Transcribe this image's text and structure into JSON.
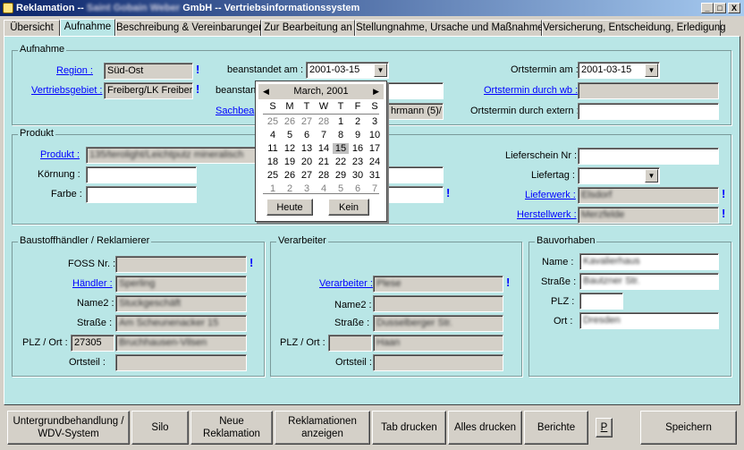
{
  "window": {
    "title": "Reklamation -- Saint Gobain Weber GmbH -- Vertriebsinformationssystem",
    "title_visible": "Reklamation --",
    "title_blurred": "Saint Gobain Weber",
    "title_rest": "GmbH -- Vertriebsinformationssystem",
    "min": "_",
    "max": "□",
    "close": "X"
  },
  "tabs": [
    "Übersicht",
    "Aufnahme",
    "Beschreibung & Vereinbarungen",
    "Zur Bearbeitung an",
    "Stellungnahme, Ursache und Maßnahmen",
    "Versicherung, Entscheidung, Erledigung"
  ],
  "aufnahme": {
    "title": "Aufnahme",
    "region_label": "Region :",
    "region_value": "Süd-Ost",
    "vertrieb_label": "Vertriebsgebiet :",
    "vertrieb_value": "Freiberg/LK Freiber",
    "beanstandet_label": "beanstandet am :",
    "beanstandet_value": "2001-03-15",
    "beanstandet2_label": "beanstan",
    "sachbe_label": "Sachbea",
    "sachbe_value": "hrmann (5)/",
    "ortstermin_label": "Ortstermin am :",
    "ortstermin_value": "2001-03-15",
    "ortstermin_wb_label": "Ortstermin durch wb :",
    "ortstermin_ext_label": "Ortstermin durch extern :"
  },
  "calendar": {
    "month": "March, 2001",
    "weekdays": [
      "S",
      "M",
      "T",
      "W",
      "T",
      "F",
      "S"
    ],
    "rows": [
      [
        [
          "25",
          1
        ],
        [
          "26",
          1
        ],
        [
          "27",
          1
        ],
        [
          "28",
          1
        ],
        [
          "1",
          0
        ],
        [
          "2",
          0
        ],
        [
          "3",
          0
        ]
      ],
      [
        [
          "4",
          0
        ],
        [
          "5",
          0
        ],
        [
          "6",
          0
        ],
        [
          "7",
          0
        ],
        [
          "8",
          0
        ],
        [
          "9",
          0
        ],
        [
          "10",
          0
        ]
      ],
      [
        [
          "11",
          0
        ],
        [
          "12",
          0
        ],
        [
          "13",
          0
        ],
        [
          "14",
          0
        ],
        [
          "15",
          2
        ],
        [
          "16",
          0
        ],
        [
          "17",
          0
        ]
      ],
      [
        [
          "18",
          0
        ],
        [
          "19",
          0
        ],
        [
          "20",
          0
        ],
        [
          "21",
          0
        ],
        [
          "22",
          0
        ],
        [
          "23",
          0
        ],
        [
          "24",
          0
        ]
      ],
      [
        [
          "25",
          0
        ],
        [
          "26",
          0
        ],
        [
          "27",
          0
        ],
        [
          "28",
          0
        ],
        [
          "29",
          0
        ],
        [
          "30",
          0
        ],
        [
          "31",
          0
        ]
      ],
      [
        [
          "1",
          1
        ],
        [
          "2",
          1
        ],
        [
          "3",
          1
        ],
        [
          "4",
          1
        ],
        [
          "5",
          1
        ],
        [
          "6",
          1
        ],
        [
          "7",
          1
        ]
      ]
    ],
    "today_btn": "Heute",
    "none_btn": "Kein"
  },
  "produkt": {
    "title": "Produkt",
    "produkt_label": "Produkt :",
    "produkt_value": "135/terolight/Leichtputz mineralisch",
    "koernung_label": "Körnung :",
    "farbe_label": "Farbe :",
    "lieferschein_label": "Lieferschein Nr :",
    "liefertag_label": "Liefertag :",
    "lieferwerk_label": "Lieferwerk :",
    "lieferwerk_value": "Elsdorf",
    "herstellwerk_label": "Herstellwerk :",
    "herstellwerk_value": "Merzfelde"
  },
  "baustoff": {
    "title": "Baustoffhändler / Reklamierer",
    "foss_label": "FOSS Nr. :",
    "haendler_label": "Händler :",
    "haendler_value": "Sperling",
    "name2_label": "Name2 :",
    "name2_value": "Stuckgeschäft",
    "strasse_label": "Straße :",
    "strasse_value": "Am Scheunenacker 15",
    "plz_label": "PLZ / Ort :",
    "plz_value": "27305",
    "ort_value": "Bruchhausen-Vilsen",
    "ortsteil_label": "Ortsteil :"
  },
  "verarbeiter": {
    "title": "Verarbeiter",
    "verarbeiter_label": "Verarbeiter :",
    "verarbeiter_value": "Plese",
    "name2_label": "Name2 :",
    "strasse_label": "Straße :",
    "strasse_value": "Dusselberger Str.",
    "plz_label": "PLZ / Ort :",
    "ort_value": "Haan",
    "ortsteil_label": "Ortsteil :"
  },
  "bauvorhaben": {
    "title": "Bauvorhaben",
    "name_label": "Name :",
    "name_value": "Kavalierhaus",
    "strasse_label": "Straße :",
    "strasse_value": "Bautzner Str.",
    "plz_label": "PLZ :",
    "ort_label": "Ort :",
    "ort_value": "Dresden"
  },
  "buttons": {
    "untergrund": "Untergrundbehandlung / WDV-System",
    "silo": "Silo",
    "neue": "Neue Reklamation",
    "anzeigen": "Reklamationen anzeigen",
    "tab_drucken": "Tab drucken",
    "alles_drucken": "Alles drucken",
    "berichte": "Berichte",
    "p": "P",
    "speichern": "Speichern"
  },
  "colors": {
    "panel": "#b9e6e6",
    "link": "#0000ff",
    "title_start": "#0a246a"
  }
}
